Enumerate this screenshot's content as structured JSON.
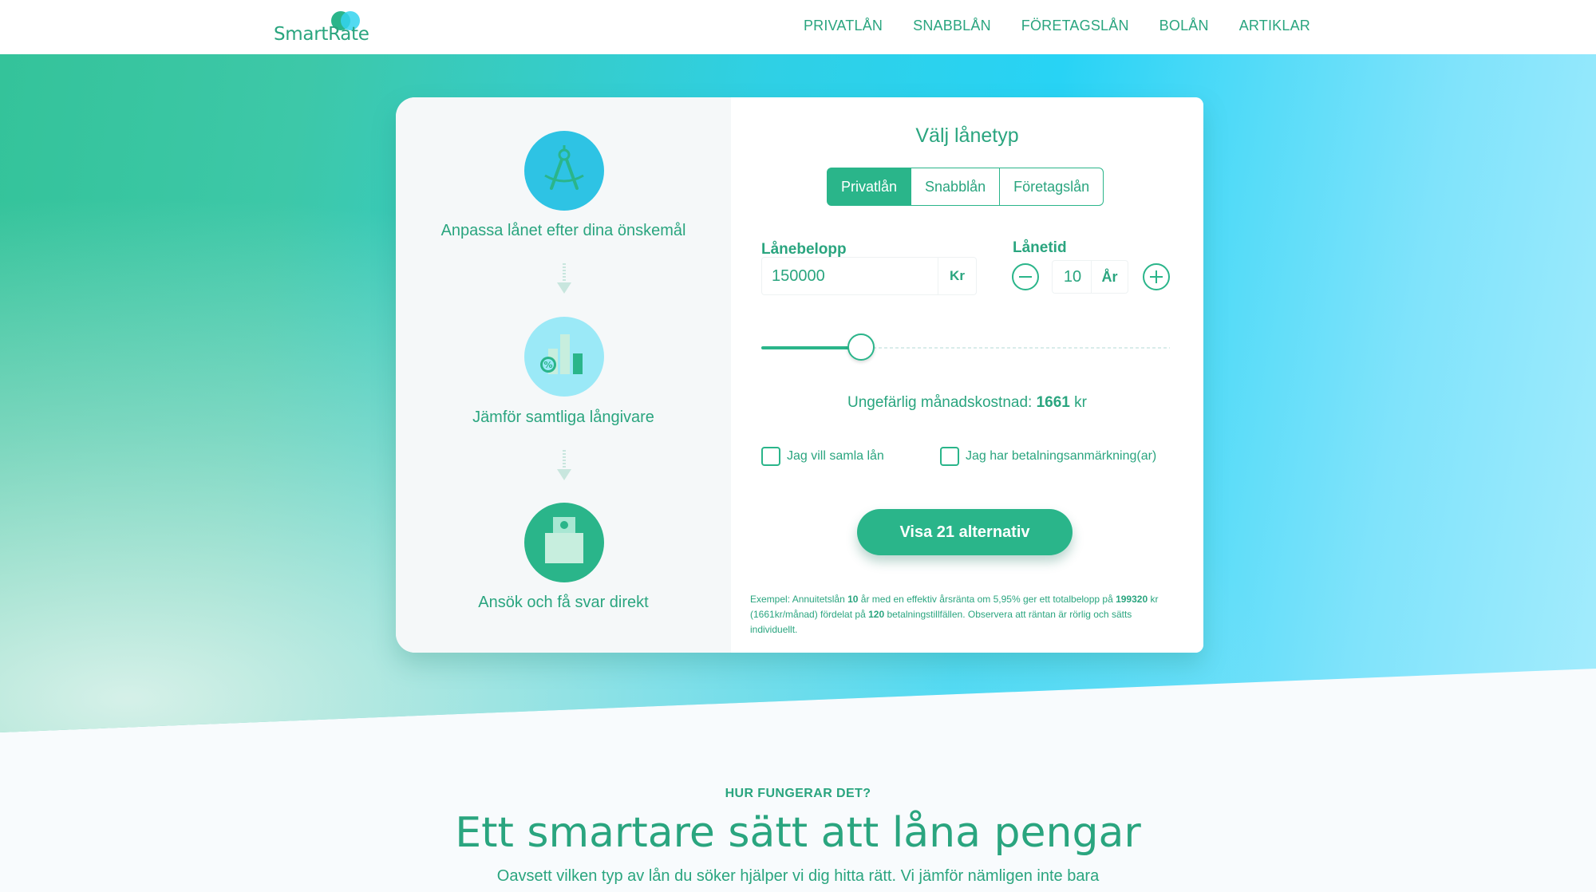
{
  "nav": {
    "logo_text": "SmartRate",
    "links": [
      "PRIVATLÅN",
      "SNABBLÅN",
      "FÖRETAGSLÅN",
      "BOLÅN",
      "ARTIKLAR"
    ]
  },
  "steps": [
    {
      "text": "Anpassa lånet efter dina önskemål",
      "icon": "compass-icon"
    },
    {
      "text": "Jämför samtliga långivare",
      "icon": "bar-chart-percent-icon"
    },
    {
      "text": "Ansök och få svar direkt",
      "icon": "bag-icon"
    }
  ],
  "form": {
    "title": "Välj lånetyp",
    "tabs": [
      "Privatlån",
      "Snabblån",
      "Företagslån"
    ],
    "selected_tab": "Privatlån",
    "amount_label": "Lånebelopp",
    "amount_value": "150000",
    "amount_unit": "Kr",
    "term_label": "Lånetid",
    "term_value": "10",
    "term_unit": "År",
    "slider_fraction": 0.245,
    "cost_prefix": "Ungefärlig månadskostnad:",
    "cost_value": "1661",
    "cost_suffix": "kr",
    "checkbox_1": "Jag vill samla lån",
    "checkbox_2": "Jag har betalningsanmärkning(ar)",
    "cta": "Visa 21 alternativ",
    "example": {
      "p1": "Exempel: Annuitetslån ",
      "b1": "10",
      "p2": " år med en effektiv årsränta om 5,95% ger ett totalbelopp på ",
      "b2": "199320",
      "p3": " kr (1661kr/månad) fördelat på ",
      "b3": "120",
      "p4": " betalningstillfällen. Observera att räntan är rörlig och sätts individuellt."
    }
  },
  "section": {
    "kicker": "HUR FUNGERAR DET?",
    "title": "Ett smartare sätt att låna pengar",
    "text": "Oavsett vilken typ av lån du söker hjälper vi dig hitta rätt. Vi jämför nämligen inte bara"
  },
  "colors": {
    "brand_green": "#2ab58a",
    "brand_cyan": "#34d3ee",
    "text_green": "#2aa57f"
  }
}
